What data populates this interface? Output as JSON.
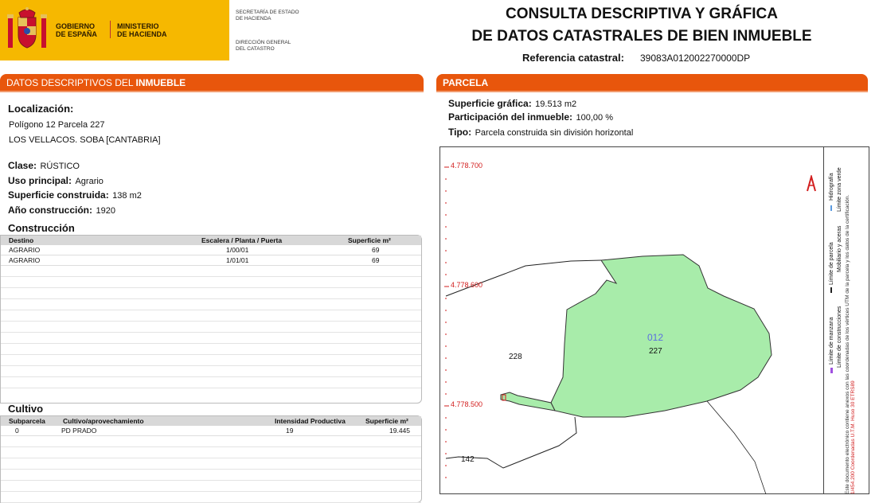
{
  "header": {
    "gov_line1": "GOBIERNO",
    "gov_line2": "DE ESPAÑA",
    "min_line1": "MINISTERIO",
    "min_line2": "DE HACIENDA",
    "sec_line1": "SECRETARÍA DE ESTADO",
    "sec_line2": "DE HACIENDA",
    "dir_line1": "DIRECCIÓN GENERAL",
    "dir_line2": "DEL CATASTRO",
    "title_line1": "CONSULTA DESCRIPTIVA Y GRÁFICA",
    "title_line2": "DE DATOS CATASTRALES DE BIEN INMUEBLE",
    "ref_label": "Referencia catastral:",
    "ref_value": "39083A012002270000DP"
  },
  "left": {
    "bar_prefix": "DATOS DESCRIPTIVOS DEL ",
    "bar_strong": "INMUEBLE",
    "loc_label": "Localización:",
    "loc_line1": "Polígono 12 Parcela 227",
    "loc_line2": "LOS VELLACOS. SOBA [CANTABRIA]",
    "clase_label": "Clase:",
    "clase_value": "RÚSTICO",
    "uso_label": "Uso principal:",
    "uso_value": "Agrario",
    "sup_label": "Superficie construida:",
    "sup_value": "138 m2",
    "ano_label": "Año construcción:",
    "ano_value": "1920",
    "construccion": {
      "title": "Construcción",
      "headers": [
        "Destino",
        "Escalera / Planta / Puerta",
        "Superficie m²"
      ],
      "rows": [
        [
          "AGRARIO",
          "1/00/01",
          "69"
        ],
        [
          "AGRARIO",
          "1/01/01",
          "69"
        ]
      ]
    },
    "cultivo": {
      "title": "Cultivo",
      "headers": [
        "Subparcela",
        "Cultivo/aprovechamiento",
        "Intensidad Productiva",
        "Superficie m²"
      ],
      "rows": [
        [
          "0",
          "PD PRADO",
          "19",
          "19.445"
        ]
      ]
    }
  },
  "right": {
    "bar_label": "PARCELA",
    "sup_label": "Superficie gráfica:",
    "sup_value": "19.513 m2",
    "part_label": "Participación del inmueble:",
    "part_value": "100,00 %",
    "tipo_label": "Tipo:",
    "tipo_value": "Parcela construida sin división horizontal"
  },
  "map": {
    "coords": [
      "4.778.700",
      "4.778.600",
      "4.778.500"
    ],
    "poly_label": "012",
    "parcel_227": "227",
    "parcel_228": "228",
    "parcel_142": "142",
    "legend_a1": "Límite de parcela",
    "legend_a2": "Hidrografía",
    "legend_b1": "Mobiliario y aceras",
    "legend_b2": "Límite zona verde",
    "legend_c1": "Límite de manzana",
    "legend_c2": "Límite de construcciones",
    "legend_note": "Este documento electrónico contiene anexos con las coordenadas de los vértices UTM de la parcela y los datos de la certificación.",
    "legend_scale": "1/454.200 Coordenadas U.T.M. Huso 30 ETRS89",
    "colors": {
      "parcel_fill": "#a8ecaa",
      "accent": "#e8560c",
      "coord_red": "#d21e1e"
    }
  }
}
